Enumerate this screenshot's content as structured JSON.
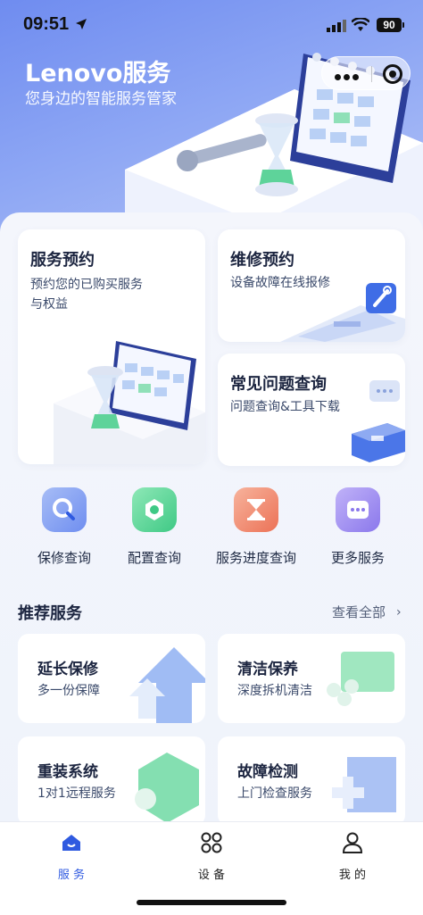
{
  "status_bar": {
    "time": "09:51",
    "battery": "90"
  },
  "brand": {
    "title": "Lenovo服务",
    "subtitle": "您身边的智能服务管家"
  },
  "service_cards": [
    {
      "title": "服务预约",
      "desc_line1": "预约您的已购买服务",
      "desc_line2": "与权益"
    },
    {
      "title": "维修预约",
      "desc": "设备故障在线报修"
    },
    {
      "title": "常见问题查询",
      "desc": "问题查询&工具下载"
    }
  ],
  "quick_actions": [
    {
      "label": "保修查询",
      "icon": "search-icon",
      "color": "#7c9bf0"
    },
    {
      "label": "配置查询",
      "icon": "gear-icon",
      "color": "#4fd08f"
    },
    {
      "label": "服务进度查询",
      "icon": "hourglass-icon",
      "color": "#f0856b"
    },
    {
      "label": "更多服务",
      "icon": "more-icon",
      "color": "#9a87ee"
    }
  ],
  "recommended": {
    "title": "推荐服务",
    "view_all": "查看全部",
    "items": [
      {
        "title": "延长保修",
        "desc": "多一份保障"
      },
      {
        "title": "清洁保养",
        "desc": "深度拆机清洁"
      },
      {
        "title": "重装系统",
        "desc": "1对1远程服务"
      },
      {
        "title": "故障检测",
        "desc": "上门检查服务"
      }
    ]
  },
  "tabbar": [
    {
      "label": "服 务",
      "icon": "home-icon",
      "active": true
    },
    {
      "label": "设 备",
      "icon": "devices-icon",
      "active": false
    },
    {
      "label": "我 的",
      "icon": "profile-icon",
      "active": false
    }
  ],
  "colors": {
    "accent": "#2f5ae0",
    "hero_start": "#6f8cf0",
    "hero_end": "#b7c6f7"
  }
}
